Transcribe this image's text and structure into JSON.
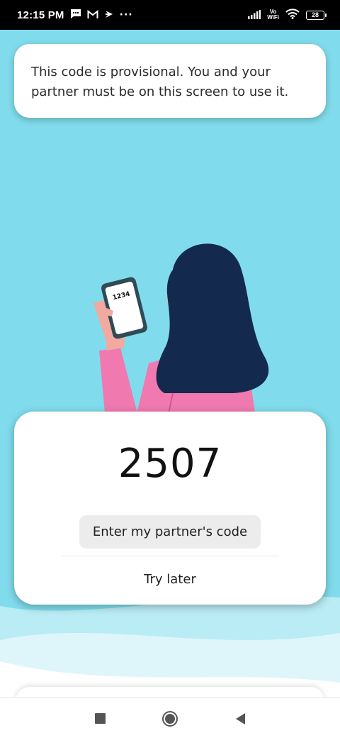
{
  "status_bar": {
    "time": "12:15 PM",
    "notification_icons": [
      "message-icon",
      "gmail-icon",
      "feedly-icon",
      "more-dots-icon"
    ],
    "more_dots": "···",
    "vowifi_top": "Vo",
    "vowifi_bottom": "WiFi",
    "battery_level": "28"
  },
  "colors": {
    "background": "#80dcec",
    "hair": "#13294d",
    "shirt": "#f07ab0",
    "skin": "#f2a9a0",
    "wave_light": "#b9ecf5",
    "wave_lighter": "#def6fa"
  },
  "toast": {
    "message": "This code is provisional. You and your partner must be on this screen to use it."
  },
  "illustration": {
    "phone_screen_code": "1234"
  },
  "code_card": {
    "code": "2507",
    "enter_code_label": "Enter my partner's code",
    "try_later_label": "Try later"
  },
  "nav_bar": {
    "buttons": [
      "recent-apps-icon",
      "home-icon",
      "back-icon"
    ]
  }
}
